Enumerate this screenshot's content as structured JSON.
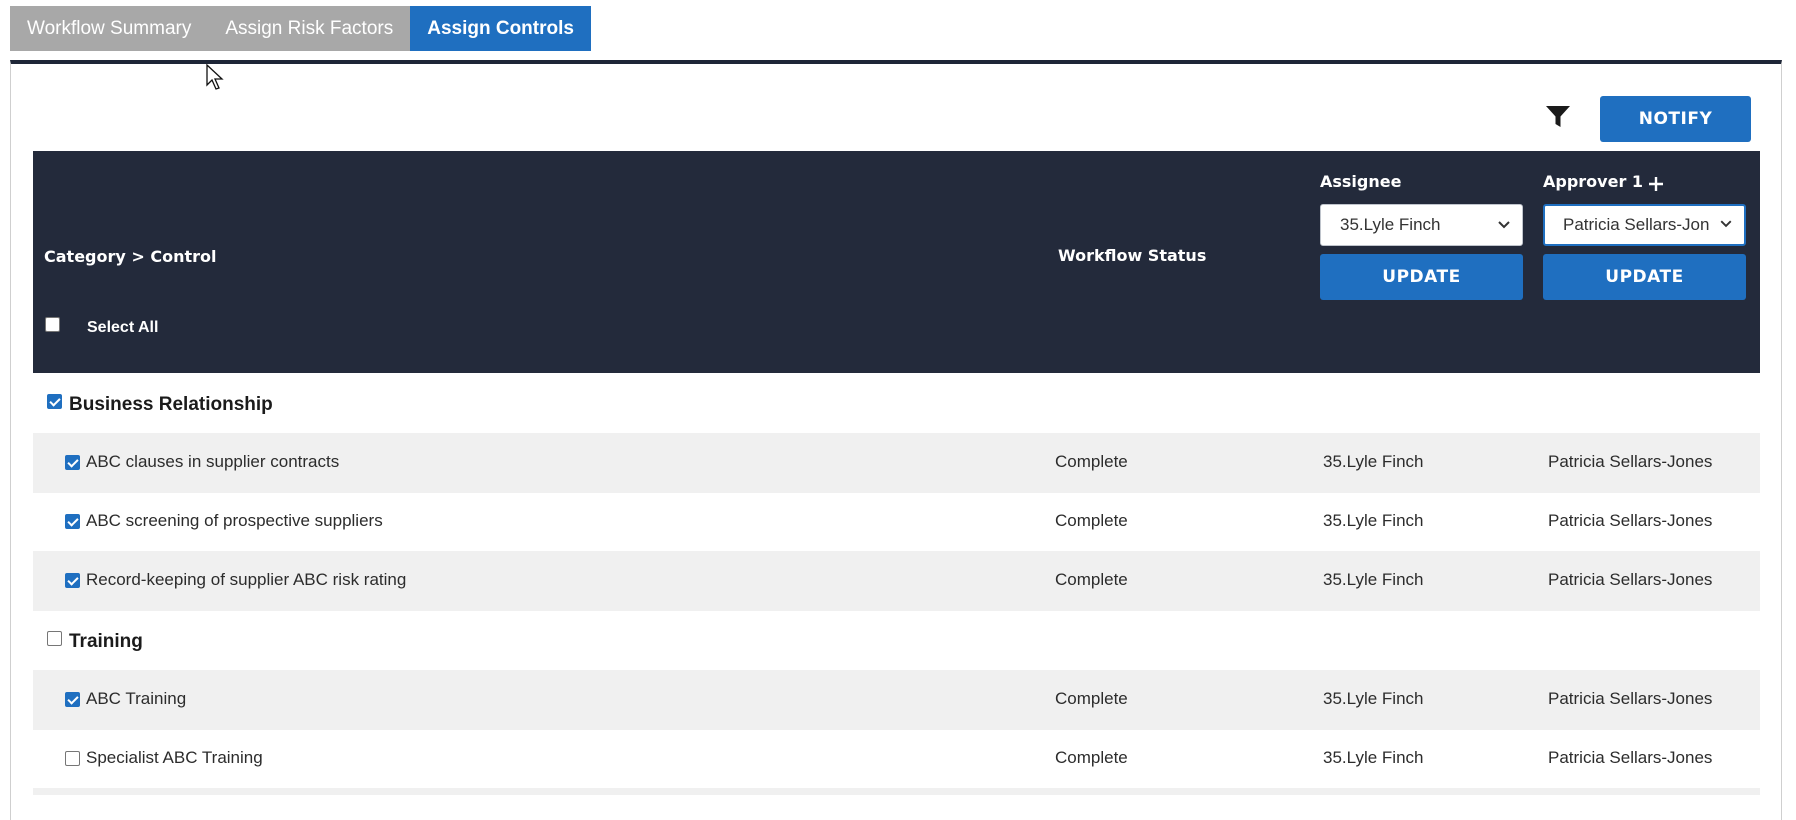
{
  "tabs": [
    {
      "label": "Workflow Summary",
      "active": false
    },
    {
      "label": "Assign Risk Factors",
      "active": false
    },
    {
      "label": "Assign Controls",
      "active": true
    }
  ],
  "toolbar": {
    "notify_label": "NOTIFY",
    "filter_icon": "filter-icon"
  },
  "table_header": {
    "category_control": "Category > Control",
    "workflow_status": "Workflow Status",
    "select_all": "Select All",
    "assignee_label": "Assignee",
    "assignee_selected": "35.Lyle Finch",
    "approver_label": "Approver 1",
    "approver_selected": "Patricia Sellars-Jon",
    "update_label": "UPDATE"
  },
  "categories": [
    {
      "name": "Business Relationship",
      "checked": true,
      "controls": [
        {
          "name": "ABC clauses in supplier contracts",
          "status": "Complete",
          "assignee": "35.Lyle Finch",
          "approver": "Patricia Sellars-Jones",
          "checked": true
        },
        {
          "name": "ABC screening of prospective suppliers",
          "status": "Complete",
          "assignee": "35.Lyle Finch",
          "approver": "Patricia Sellars-Jones",
          "checked": true
        },
        {
          "name": "Record-keeping of supplier ABC risk rating",
          "status": "Complete",
          "assignee": "35.Lyle Finch",
          "approver": "Patricia Sellars-Jones",
          "checked": true
        }
      ]
    },
    {
      "name": "Training",
      "checked": false,
      "controls": [
        {
          "name": "ABC Training",
          "status": "Complete",
          "assignee": "35.Lyle Finch",
          "approver": "Patricia Sellars-Jones",
          "checked": true
        },
        {
          "name": "Specialist ABC Training",
          "status": "Complete",
          "assignee": "35.Lyle Finch",
          "approver": "Patricia Sellars-Jones",
          "checked": false
        }
      ]
    }
  ],
  "colors": {
    "accent": "#1f6fc0",
    "header_bg": "#232a3b",
    "tab_inactive": "#a8a8a8",
    "row_shade": "#f0f0f0"
  }
}
